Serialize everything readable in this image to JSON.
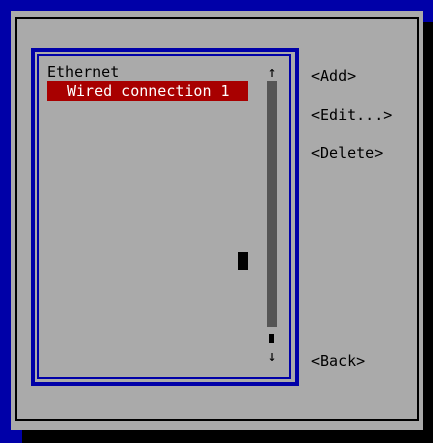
{
  "connections": {
    "group_header": "Ethernet",
    "items": [
      {
        "label": "Wired connection 1",
        "selected": true
      }
    ]
  },
  "scrollbar": {
    "up_arrow": "↑",
    "down_arrow": "↓"
  },
  "buttons": {
    "add": "<Add>",
    "edit": "<Edit...>",
    "delete": "<Delete>",
    "back": "<Back>"
  },
  "colors": {
    "background": "#0000a8",
    "dialog": "#aaaaaa",
    "selection": "#a80000",
    "scroll_track": "#555555"
  }
}
